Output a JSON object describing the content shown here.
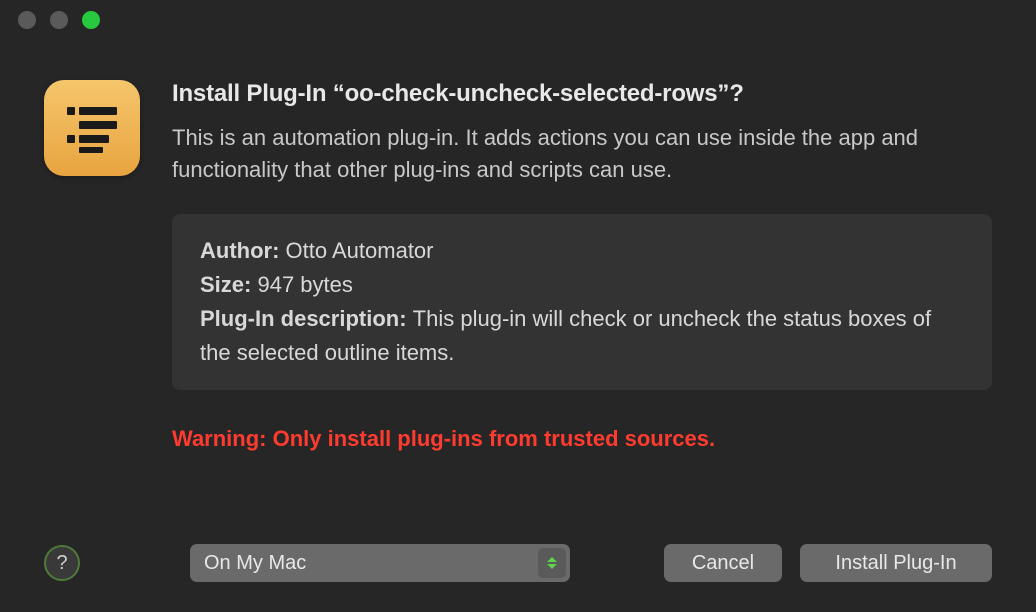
{
  "dialog": {
    "title": "Install Plug-In “oo-check-uncheck-selected-rows”?",
    "subtitle": "This is an automation plug-in. It adds actions you can use inside the app and functionality that other plug-ins and scripts can use.",
    "info": {
      "author_label": "Author:",
      "author_value": "Otto Automator",
      "size_label": "Size:",
      "size_value": "947 bytes",
      "desc_label": "Plug-In description:",
      "desc_value": "This plug-in will check or uncheck the status boxes of the selected outline items."
    },
    "warning": "Warning: Only install plug-ins from trusted sources."
  },
  "footer": {
    "location_selected": "On My Mac",
    "cancel_label": "Cancel",
    "install_label": "Install Plug-In",
    "help_label": "?"
  },
  "icons": {
    "app": "outliner-icon"
  }
}
